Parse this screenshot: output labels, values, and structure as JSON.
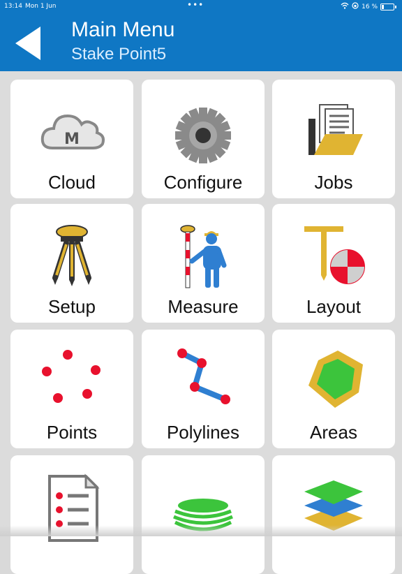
{
  "status_bar": {
    "time": "13:14",
    "date": "Mon 1 Jun",
    "battery": "16 %"
  },
  "header": {
    "title": "Main Menu",
    "subtitle": "Stake Point5"
  },
  "menu": {
    "items": [
      {
        "label": "Cloud",
        "icon": "cloud-icon"
      },
      {
        "label": "Configure",
        "icon": "gear-icon"
      },
      {
        "label": "Jobs",
        "icon": "folder-documents-icon"
      },
      {
        "label": "Setup",
        "icon": "tripod-icon"
      },
      {
        "label": "Measure",
        "icon": "surveyor-icon"
      },
      {
        "label": "Layout",
        "icon": "stakeout-icon"
      },
      {
        "label": "Points",
        "icon": "points-icon"
      },
      {
        "label": "Polylines",
        "icon": "polyline-icon"
      },
      {
        "label": "Areas",
        "icon": "area-icon"
      },
      {
        "label": "",
        "icon": "report-list-icon"
      },
      {
        "label": "",
        "icon": "surface-icon"
      },
      {
        "label": "",
        "icon": "layers-icon"
      }
    ]
  },
  "colors": {
    "header_blue": "#0f77c4",
    "red": "#e8112d",
    "gold": "#e0b432",
    "green": "#3cc43c",
    "blue_icon": "#2f7fd1"
  }
}
